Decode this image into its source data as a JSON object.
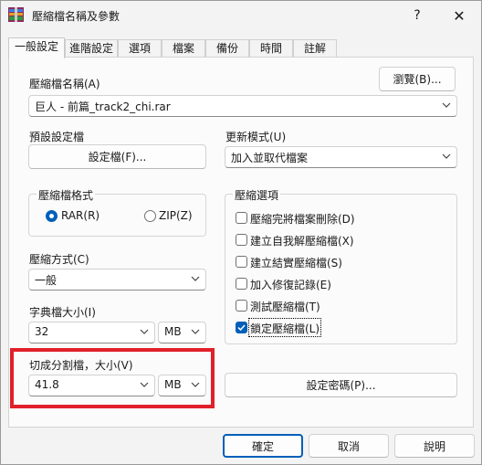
{
  "window": {
    "title": "壓縮檔名稱及參數",
    "help": "?",
    "close": "✕"
  },
  "tabs": [
    "一般設定",
    "進階設定",
    "選項",
    "檔案",
    "備份",
    "時間",
    "註解"
  ],
  "archive": {
    "label": "壓縮檔名稱(A)",
    "value": "巨人 - 前篇_track2_chi.rar",
    "browse": "瀏覽(B)..."
  },
  "profile": {
    "label": "預設設定檔",
    "button": "設定檔(F)..."
  },
  "update": {
    "label": "更新模式(U)",
    "value": "加入並取代檔案"
  },
  "format": {
    "title": "壓縮檔格式",
    "rar": "RAR(R)",
    "zip": "ZIP(Z)",
    "selected": "RAR"
  },
  "method": {
    "label": "壓縮方式(C)",
    "value": "一般"
  },
  "dict": {
    "label": "字典檔大小(I)",
    "value": "32",
    "unit": "MB"
  },
  "split": {
    "label": "切成分割檔，大小(V)",
    "value": "41.8",
    "unit": "MB"
  },
  "options": {
    "title": "壓縮選項",
    "items": [
      {
        "label": "壓縮完將檔案刪除(D)",
        "checked": false
      },
      {
        "label": "建立自我解壓縮檔(X)",
        "checked": false
      },
      {
        "label": "建立結實壓縮檔(S)",
        "checked": false
      },
      {
        "label": "加入修復記錄(E)",
        "checked": false
      },
      {
        "label": "測試壓縮檔(T)",
        "checked": false
      },
      {
        "label": "鎖定壓縮檔(L)",
        "checked": true
      }
    ]
  },
  "password_button": "設定密碼(P)...",
  "footer": {
    "ok": "確定",
    "cancel": "取消",
    "help": "說明"
  },
  "colors": {
    "accent": "#005fb8",
    "highlight": "#e0202a"
  }
}
